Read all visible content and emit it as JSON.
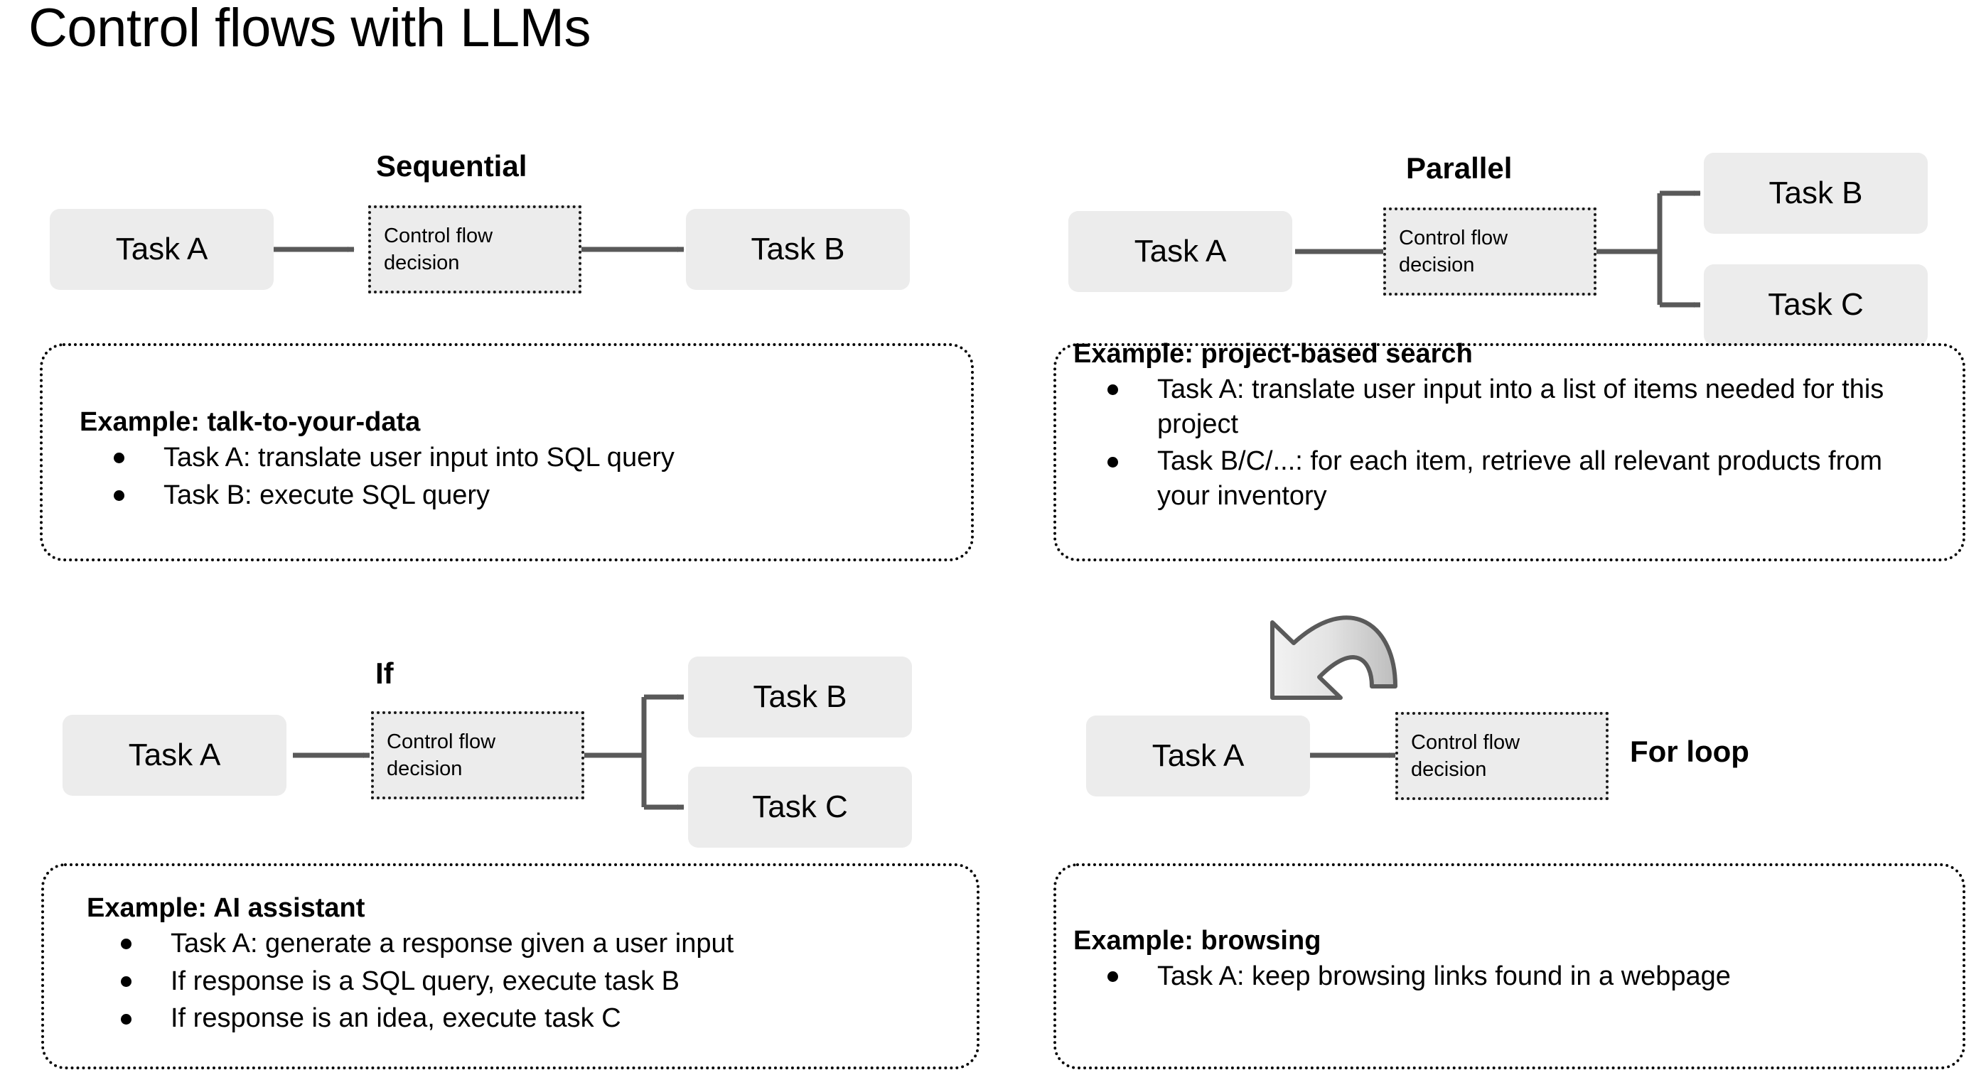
{
  "slide": {
    "title": "Control flows with LLMs",
    "background": "#ffffff"
  },
  "colors": {
    "box_fill": "#ececec",
    "arrow": "#595959",
    "text": "#000000",
    "loop_arrow_fill": "#c9c9c9",
    "loop_arrow_stroke": "#5a5a5a"
  },
  "common": {
    "decision_line1": "Control flow",
    "decision_line2": "decision",
    "task_a": "Task A",
    "task_b": "Task B",
    "task_c": "Task C"
  },
  "quadrants": {
    "sequential": {
      "flow_label": "Sequential",
      "nodes": {
        "a": "Task A",
        "decision_line1": "Control flow",
        "decision_line2": "decision",
        "b": "Task B"
      },
      "example": {
        "title": "Example: talk-to-your-data",
        "items": [
          "Task A: translate user input into SQL query",
          "Task B: execute SQL query"
        ]
      }
    },
    "parallel": {
      "flow_label": "Parallel",
      "nodes": {
        "a": "Task A",
        "decision_line1": "Control flow",
        "decision_line2": "decision",
        "b": "Task B",
        "c": "Task C"
      },
      "example": {
        "title": "Example: project-based search",
        "items": [
          "Task A: translate user input into a list of items needed for this project",
          "Task B/C/...: for each item, retrieve all relevant products from your inventory"
        ]
      }
    },
    "if": {
      "flow_label": "If",
      "nodes": {
        "a": "Task A",
        "decision_line1": "Control flow",
        "decision_line2": "decision",
        "b": "Task B",
        "c": "Task C"
      },
      "example": {
        "title": "Example: AI assistant",
        "items": [
          "Task A: generate a response given a user input",
          "If response is a SQL query, execute task B",
          "If response is an idea, execute task C"
        ]
      }
    },
    "forloop": {
      "flow_label": "For loop",
      "nodes": {
        "a": "Task A",
        "decision_line1": "Control flow",
        "decision_line2": "decision"
      },
      "example": {
        "title": "Example: browsing",
        "items": [
          "Task A: keep browsing links found in a webpage"
        ]
      }
    }
  }
}
